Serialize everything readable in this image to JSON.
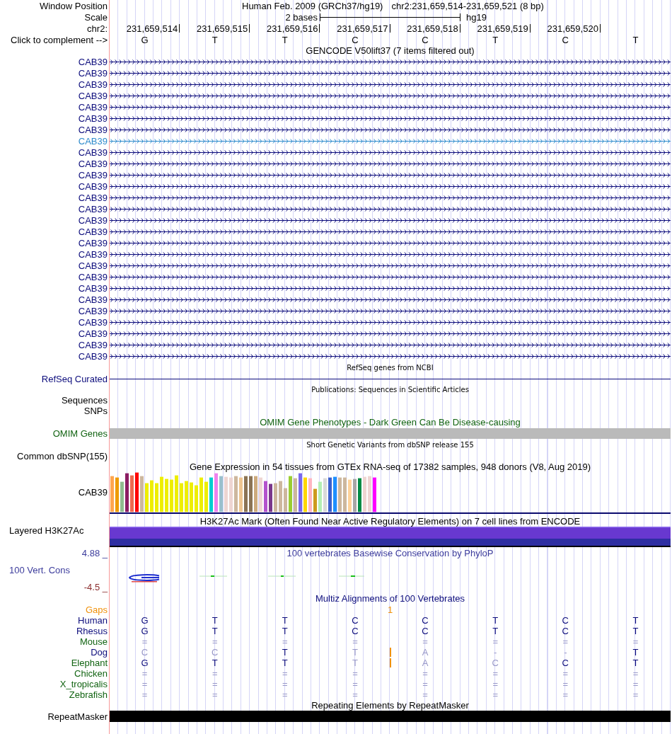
{
  "header": {
    "label": "Window Position",
    "assembly": "Human Feb. 2009 (GRCh37/hg19)",
    "position": "chr2:231,659,514-231,659,521 (8 bp)"
  },
  "scale": {
    "label": "Scale",
    "span": "2 bases",
    "assembly": "hg19"
  },
  "ruler": {
    "label": "chr2:",
    "ticks": [
      "231,659,514",
      "231,659,515",
      "231,659,516",
      "231,659,517",
      "231,659,518",
      "231,659,519",
      "231,659,520"
    ]
  },
  "sequence": {
    "label": "Click to complement -->",
    "bases": [
      "G",
      "T",
      "T",
      "C",
      "C",
      "T",
      "C",
      "T"
    ]
  },
  "tracks": [
    {
      "kind": "genes",
      "title": "GENCODE V50lift37 (7 items filtered out)",
      "items": [
        {
          "name": "CAB39",
          "color": "#0c0c7c"
        },
        {
          "name": "CAB39",
          "color": "#0c0c7c"
        },
        {
          "name": "CAB39",
          "color": "#0c0c7c"
        },
        {
          "name": "CAB39",
          "color": "#0c0c7c"
        },
        {
          "name": "CAB39",
          "color": "#0c0c7c"
        },
        {
          "name": "CAB39",
          "color": "#0c0c7c"
        },
        {
          "name": "CAB39",
          "color": "#0c0c7c"
        },
        {
          "name": "CAB39",
          "color": "#2e8bcc"
        },
        {
          "name": "CAB39",
          "color": "#0c0c7c"
        },
        {
          "name": "CAB39",
          "color": "#0c0c7c"
        },
        {
          "name": "CAB39",
          "color": "#0c0c7c"
        },
        {
          "name": "CAB39",
          "color": "#0c0c7c"
        },
        {
          "name": "CAB39",
          "color": "#0c0c7c"
        },
        {
          "name": "CAB39",
          "color": "#0c0c7c"
        },
        {
          "name": "CAB39",
          "color": "#0c0c7c"
        },
        {
          "name": "CAB39",
          "color": "#0c0c7c"
        },
        {
          "name": "CAB39",
          "color": "#0c0c7c"
        },
        {
          "name": "CAB39",
          "color": "#0c0c7c"
        },
        {
          "name": "CAB39",
          "color": "#0c0c7c"
        },
        {
          "name": "CAB39",
          "color": "#0c0c7c"
        },
        {
          "name": "CAB39",
          "color": "#0c0c7c"
        },
        {
          "name": "CAB39",
          "color": "#0c0c7c"
        },
        {
          "name": "CAB39",
          "color": "#0c0c7c"
        },
        {
          "name": "CAB39",
          "color": "#0c0c7c"
        },
        {
          "name": "CAB39",
          "color": "#0c0c7c"
        },
        {
          "name": "CAB39",
          "color": "#0c0c7c"
        },
        {
          "name": "CAB39",
          "color": "#0c0c7c"
        }
      ]
    },
    {
      "kind": "line",
      "title": "RefSeq genes from NCBI",
      "label": "RefSeq Curated",
      "color": "#0c0c7c"
    },
    {
      "kind": "labels",
      "title": "Publications: Sequences in Scientific Articles",
      "labels": [
        "Sequences",
        "SNPs"
      ]
    },
    {
      "kind": "bar",
      "title": "OMIM Gene Phenotypes - Dark Green Can Be Disease-causing",
      "label": "OMIM Genes",
      "color": "#126412"
    },
    {
      "kind": "empty",
      "title": "Short Genetic Variants from dbSNP release 155",
      "label": "Common dbSNP(155)"
    },
    {
      "kind": "expression",
      "title": "Gene Expression in 54 tissues from GTEx RNA-seq of 17382 samples, 948 donors (V8, Aug 2019)",
      "label": "CAB39"
    },
    {
      "kind": "layered",
      "title": "H3K27Ac Mark (Often Found Near Active Regulatory Elements) on 7 cell lines from ENCODE",
      "label": "Layered H3K27Ac"
    },
    {
      "kind": "conservation",
      "title": "100 vertebrates Basewise Conservation by PhyloP",
      "label": "100 Vert. Cons",
      "max": "4.88 _",
      "min": "-4.5 _",
      "color": "#3c3c9c"
    },
    {
      "kind": "alignment",
      "title": "Multiz Alignments of 100 Vertebrates",
      "color": "#0c0c7c",
      "gaps": {
        "label": "Gaps",
        "count": "1",
        "color": "#f0920c"
      },
      "species": [
        {
          "name": "Human",
          "color": "#0c0c7c",
          "bases": [
            {
              "kind": "base",
              "text": "G",
              "match": true
            },
            {
              "kind": "base",
              "text": "T",
              "match": true
            },
            {
              "kind": "base",
              "text": "T",
              "match": true
            },
            {
              "kind": "base",
              "text": "C",
              "match": true
            },
            {
              "kind": "base",
              "text": "C",
              "match": true
            },
            {
              "kind": "base",
              "text": "T",
              "match": true
            },
            {
              "kind": "base",
              "text": "C",
              "match": true
            },
            {
              "kind": "base",
              "text": "T",
              "match": true
            }
          ]
        },
        {
          "name": "Rhesus",
          "color": "#0c0c7c",
          "bases": [
            {
              "kind": "base",
              "text": "G",
              "match": true
            },
            {
              "kind": "base",
              "text": "T",
              "match": true
            },
            {
              "kind": "base",
              "text": "T",
              "match": true
            },
            {
              "kind": "base",
              "text": "C",
              "match": true
            },
            {
              "kind": "base",
              "text": "C",
              "match": true
            },
            {
              "kind": "base",
              "text": "T",
              "match": true
            },
            {
              "kind": "base",
              "text": "C",
              "match": true
            },
            {
              "kind": "base",
              "text": "T",
              "match": true
            }
          ]
        },
        {
          "name": "Mouse",
          "color": "#126412",
          "bases": [
            {
              "kind": "base",
              "text": "=",
              "match": false
            },
            {
              "kind": "base",
              "text": "=",
              "match": false
            },
            {
              "kind": "base",
              "text": "=",
              "match": false
            },
            {
              "kind": "base",
              "text": "=",
              "match": false
            },
            {
              "kind": "base",
              "text": "=",
              "match": false
            },
            {
              "kind": "base",
              "text": "=",
              "match": false
            },
            {
              "kind": "base",
              "text": "=",
              "match": false
            },
            {
              "kind": "base",
              "text": "=",
              "match": false
            }
          ]
        },
        {
          "name": "Dog",
          "color": "#0c0c7c",
          "bases": [
            {
              "kind": "base",
              "text": "C",
              "match": false
            },
            {
              "kind": "base",
              "text": "C",
              "match": false
            },
            {
              "kind": "base",
              "text": "T",
              "match": true
            },
            {
              "kind": "base",
              "text": "T",
              "match": false
            },
            {
              "kind": "insertion"
            },
            {
              "kind": "base",
              "text": "A",
              "match": false
            },
            {
              "kind": "base",
              "text": "-",
              "match": false
            },
            {
              "kind": "base",
              "text": "-",
              "match": false
            },
            {
              "kind": "base",
              "text": "T",
              "match": true
            }
          ]
        },
        {
          "name": "Elephant",
          "color": "#126412",
          "bases": [
            {
              "kind": "base",
              "text": "G",
              "match": true
            },
            {
              "kind": "base",
              "text": "T",
              "match": true
            },
            {
              "kind": "base",
              "text": "T",
              "match": true
            },
            {
              "kind": "base",
              "text": "T",
              "match": false
            },
            {
              "kind": "insertion"
            },
            {
              "kind": "base",
              "text": "A",
              "match": false
            },
            {
              "kind": "base",
              "text": "C",
              "match": false
            },
            {
              "kind": "base",
              "text": "C",
              "match": true
            },
            {
              "kind": "base",
              "text": "T",
              "match": true
            }
          ]
        },
        {
          "name": "Chicken",
          "color": "#126412",
          "bases": [
            {
              "kind": "base",
              "text": "=",
              "match": false
            },
            {
              "kind": "base",
              "text": "=",
              "match": false
            },
            {
              "kind": "base",
              "text": "=",
              "match": false
            },
            {
              "kind": "base",
              "text": "=",
              "match": false
            },
            {
              "kind": "base",
              "text": "=",
              "match": false
            },
            {
              "kind": "base",
              "text": "=",
              "match": false
            },
            {
              "kind": "base",
              "text": "=",
              "match": false
            },
            {
              "kind": "base",
              "text": "=",
              "match": false
            }
          ]
        },
        {
          "name": "X_tropicalis",
          "color": "#126412",
          "bases": [
            {
              "kind": "base",
              "text": "=",
              "match": false
            },
            {
              "kind": "base",
              "text": "=",
              "match": false
            },
            {
              "kind": "base",
              "text": "=",
              "match": false
            },
            {
              "kind": "base",
              "text": "=",
              "match": false
            },
            {
              "kind": "base",
              "text": "=",
              "match": false
            },
            {
              "kind": "base",
              "text": "=",
              "match": false
            },
            {
              "kind": "base",
              "text": "=",
              "match": false
            },
            {
              "kind": "base",
              "text": "=",
              "match": false
            }
          ]
        },
        {
          "name": "Zebrafish",
          "color": "#126412",
          "bases": [
            {
              "kind": "base",
              "text": "=",
              "match": false
            },
            {
              "kind": "base",
              "text": "=",
              "match": false
            },
            {
              "kind": "base",
              "text": "=",
              "match": false
            },
            {
              "kind": "base",
              "text": "=",
              "match": false
            },
            {
              "kind": "base",
              "text": "=",
              "match": false
            },
            {
              "kind": "base",
              "text": "=",
              "match": false
            },
            {
              "kind": "base",
              "text": "=",
              "match": false
            },
            {
              "kind": "base",
              "text": "=",
              "match": false
            }
          ]
        }
      ]
    },
    {
      "kind": "repeats",
      "title": "Repeating Elements by RepeatMasker",
      "label": "RepeatMasker"
    }
  ]
}
